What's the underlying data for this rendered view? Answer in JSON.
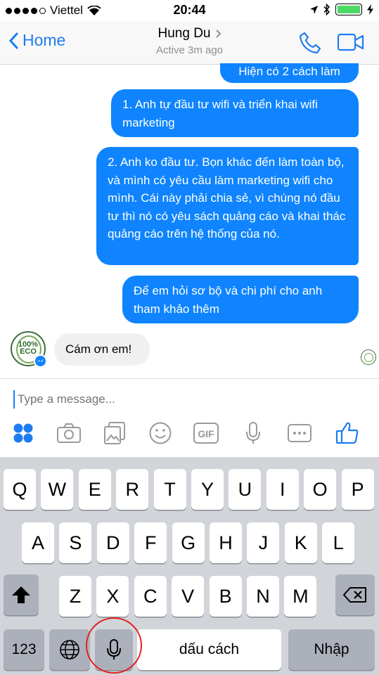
{
  "status_bar": {
    "carrier": "Viettel",
    "time": "20:44"
  },
  "nav": {
    "back_label": "Home",
    "contact_name": "Hung Du",
    "contact_status": "Active 3m ago"
  },
  "messages": [
    {
      "dir": "out",
      "text": "Hiện có 2 cách làm"
    },
    {
      "dir": "out",
      "text": "1. Anh tự đầu tư wifi và triển khai wifi marketing"
    },
    {
      "dir": "out",
      "text": "2. Anh ko đầu tư. Bọn khác đến làm toàn bộ, và mình có yêu cầu làm marketing wifi cho mình. Cái này phải chia sẻ, vì chúng nó đầu tư thì nó có yêu sách quảng cáo và khai thác quảng cáo trên hệ thống của nó."
    },
    {
      "dir": "out",
      "text": "Để em hỏi sơ bộ và chi phí cho anh tham khảo thêm"
    },
    {
      "dir": "in",
      "text": "Cám ơn em!"
    }
  ],
  "composer": {
    "placeholder": "Type a message..."
  },
  "toolbar": [
    "emoji-grid-icon",
    "camera-icon",
    "gallery-icon",
    "smiley-icon",
    "gif-icon",
    "microphone-icon",
    "more-icon",
    "thumbs-up-icon"
  ],
  "toolbar_gif_label": "GIF",
  "keyboard": {
    "row1": [
      "Q",
      "W",
      "E",
      "R",
      "T",
      "Y",
      "U",
      "I",
      "O",
      "P"
    ],
    "row2": [
      "A",
      "S",
      "D",
      "F",
      "G",
      "H",
      "J",
      "K",
      "L"
    ],
    "row3": [
      "Z",
      "X",
      "C",
      "V",
      "B",
      "N",
      "M"
    ],
    "numbers_label": "123",
    "space_label": "dấu cách",
    "return_label": "Nhập"
  },
  "colors": {
    "accent": "#0f84fe",
    "annotation": "#e02020"
  }
}
